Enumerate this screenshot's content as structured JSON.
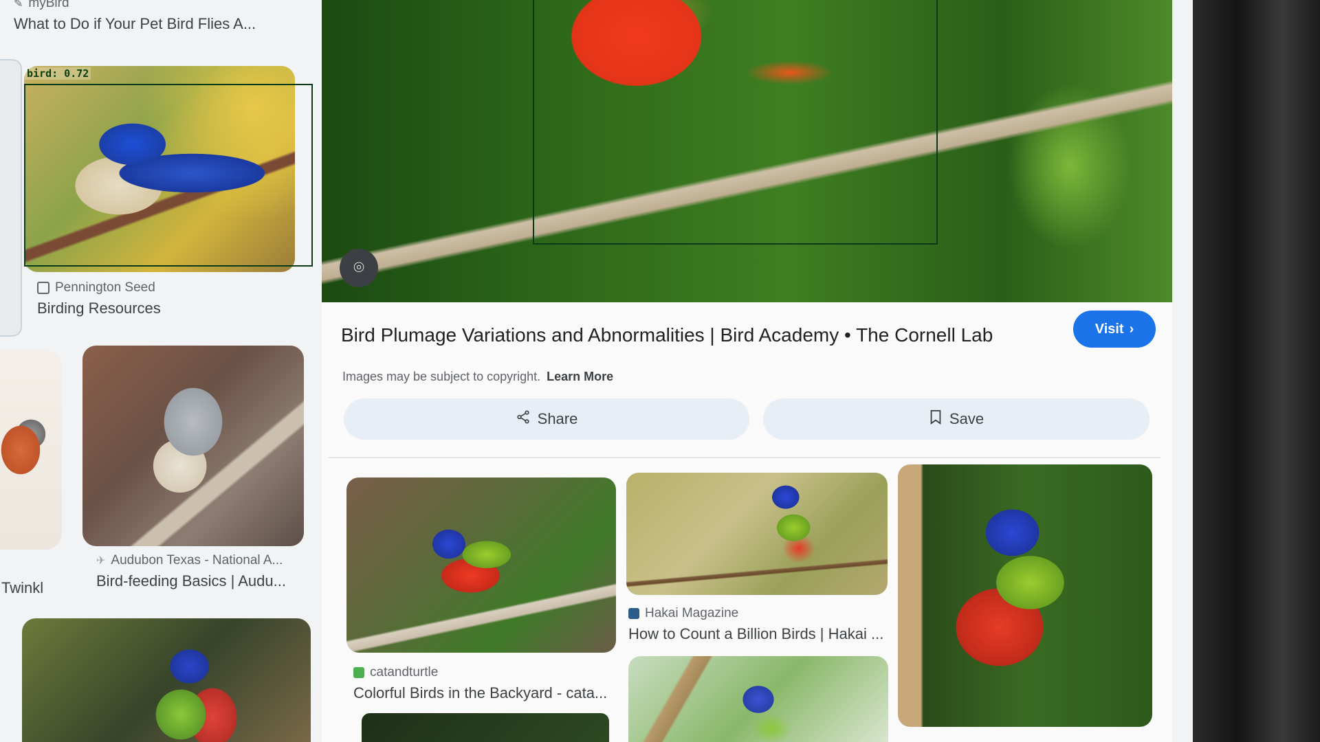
{
  "left_results": [
    {
      "source": "myBird",
      "title": "What to Do if Your Pet Bird Flies A..."
    },
    {
      "source": "Pennington Seed",
      "title": "Birding Resources"
    },
    {
      "source": "",
      "title": "Twinkl"
    },
    {
      "source": "Audubon Texas - National A...",
      "title": "Bird-feeding Basics | Audu..."
    }
  ],
  "detection": {
    "label": "bird: 0.72"
  },
  "preview": {
    "title": "Bird Plumage Variations and Abnormalities | Bird Academy • The Cornell Lab",
    "visit_label": "Visit",
    "copyright_text": "Images may be subject to copyright.",
    "learn_more": "Learn More",
    "share_label": "Share",
    "save_label": "Save"
  },
  "related": [
    {
      "source": "catandturtle",
      "title": "Colorful Birds in the Backyard - cata..."
    },
    {
      "source": "Hakai Magazine",
      "title": "How to Count a Billion Birds | Hakai ..."
    }
  ],
  "colors": {
    "accent": "#1a73e8",
    "detection_box": "#0b3a1a"
  }
}
